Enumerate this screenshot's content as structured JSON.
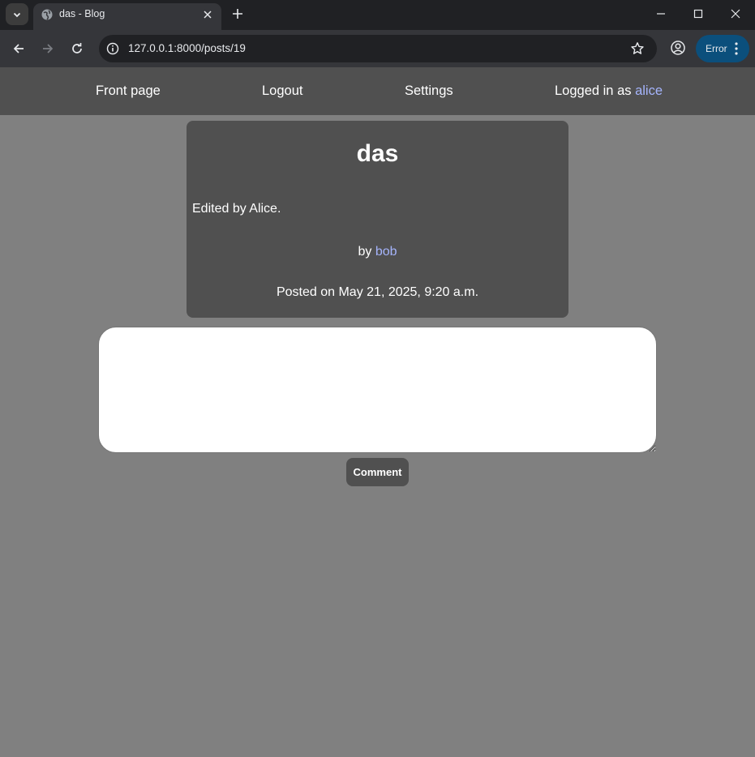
{
  "browser": {
    "tab_title": "das - Blog",
    "url": "127.0.0.1:8000/posts/19",
    "error_chip_label": "Error"
  },
  "navbar": {
    "front_page": "Front page",
    "logout": "Logout",
    "settings": "Settings",
    "logged_in_prefix": "Logged in as",
    "username": "alice"
  },
  "post": {
    "title": "das",
    "body": "Edited by Alice.",
    "by_prefix": "by",
    "author": "bob",
    "posted_on": "Posted on May 21, 2025, 9:20 a.m."
  },
  "comment_form": {
    "textarea_value": "",
    "submit_label": "Comment"
  },
  "colors": {
    "page_bg": "#808080",
    "navbar_bg": "#505050",
    "card_bg": "#505050",
    "link": "#a5b4fc",
    "chrome_dark": "#202124",
    "chrome_toolbar": "#35363a",
    "error_chip": "#0b4f7c"
  },
  "icons": {
    "tab_search": "chevron-down-icon",
    "favicon": "globe-icon",
    "tab_close": "close-icon",
    "new_tab": "plus-icon",
    "minimize": "minimize-icon",
    "maximize": "maximize-icon",
    "close_window": "close-icon",
    "back": "arrow-left-icon",
    "forward": "arrow-right-icon",
    "reload": "reload-icon",
    "site_info": "info-icon",
    "bookmark": "star-icon",
    "profile": "profile-icon",
    "menu": "more-vert-icon"
  }
}
